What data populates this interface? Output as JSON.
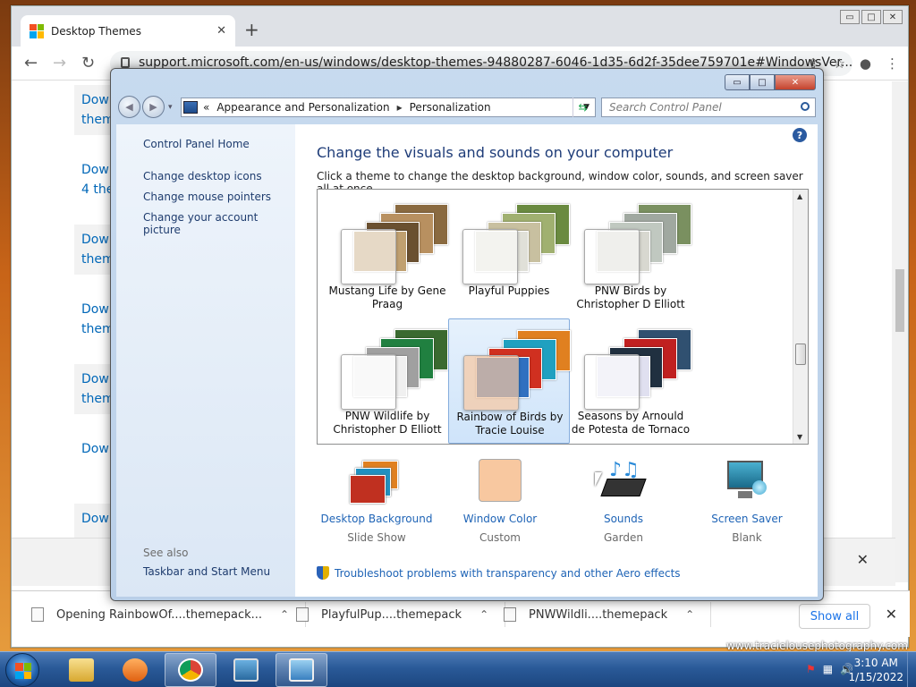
{
  "browser": {
    "tab_title": "Desktop Themes",
    "tab_close": "✕",
    "new_tab": "+",
    "url": "support.microsoft.com/en-us/windows/desktop-themes-94880287-6046-1d35-6d2f-35dee759701e#WindowsVer...",
    "window_controls": [
      "▭",
      "□",
      "✕"
    ],
    "page_links": [
      {
        "line1": "Down",
        "line2": "them"
      },
      {
        "line1": "Down",
        "line2": "4 the"
      },
      {
        "line1": "Down",
        "line2": "them"
      },
      {
        "line1": "Down",
        "line2": "them"
      },
      {
        "line1": "Down",
        "line2": "them"
      },
      {
        "line1": "Down",
        "line2": ""
      },
      {
        "line1": "Down",
        "line2": ""
      }
    ],
    "downloads": [
      {
        "name": "Opening RainbowOf....themepack..."
      },
      {
        "name": "PlayfulPup....themepack"
      },
      {
        "name": "PNWWildli....themepack"
      }
    ],
    "show_all": "Show all",
    "close_x": "✕",
    "watermark": "www.tracielousephotography.com"
  },
  "control_panel": {
    "breadcrumb": [
      "«",
      "Appearance and Personalization",
      "▸",
      "Personalization"
    ],
    "search_placeholder": "Search Control Panel",
    "left_links": [
      "Control Panel Home",
      "Change desktop icons",
      "Change mouse pointers",
      "Change your account picture"
    ],
    "see_also": "See also",
    "see_also_links": [
      "Taskbar and Start Menu"
    ],
    "help": "?",
    "heading": "Change the visuals and sounds on your computer",
    "description": "Click a theme to change the desktop background, window color, sounds, and screen saver all at once.",
    "themes": [
      {
        "name": "Mustang Life by Gene Praag",
        "colors": [
          "#8a6a40",
          "#b89060",
          "#6a5030",
          "#c0a070"
        ]
      },
      {
        "name": "Playful Puppies",
        "colors": [
          "#6a8a40",
          "#a0b070",
          "#c8c0a0",
          "#e0e0d8"
        ]
      },
      {
        "name": "PNW Birds by Christopher D Elliott",
        "colors": [
          "#7a9060",
          "#a0a8a0",
          "#c0c8c0",
          "#d8d8d0"
        ]
      },
      {
        "name": "PNW Wildlife by Christopher D Elliott",
        "colors": [
          "#3a6a30",
          "#208040",
          "#a0a0a0",
          "#f0f0f0"
        ]
      },
      {
        "name": "Rainbow of Birds by Tracie Louise",
        "colors": [
          "#e08020",
          "#20a0c0",
          "#d03020",
          "#3070c0"
        ],
        "selected": true
      },
      {
        "name": "Seasons by Arnould de Potesta de Tornaco",
        "colors": [
          "#305070",
          "#c02020",
          "#203040",
          "#e0e0f0"
        ]
      }
    ],
    "options": [
      {
        "label": "Desktop Background",
        "sub": "Slide Show"
      },
      {
        "label": "Window Color",
        "sub": "Custom"
      },
      {
        "label": "Sounds",
        "sub": "Garden"
      },
      {
        "label": "Screen Saver",
        "sub": "Blank"
      }
    ],
    "window_color_swatch": "#f8c8a0",
    "troubleshoot": "Troubleshoot problems with transparency and other Aero effects"
  },
  "taskbar": {
    "time": "3:10 AM",
    "date": "1/15/2022"
  }
}
